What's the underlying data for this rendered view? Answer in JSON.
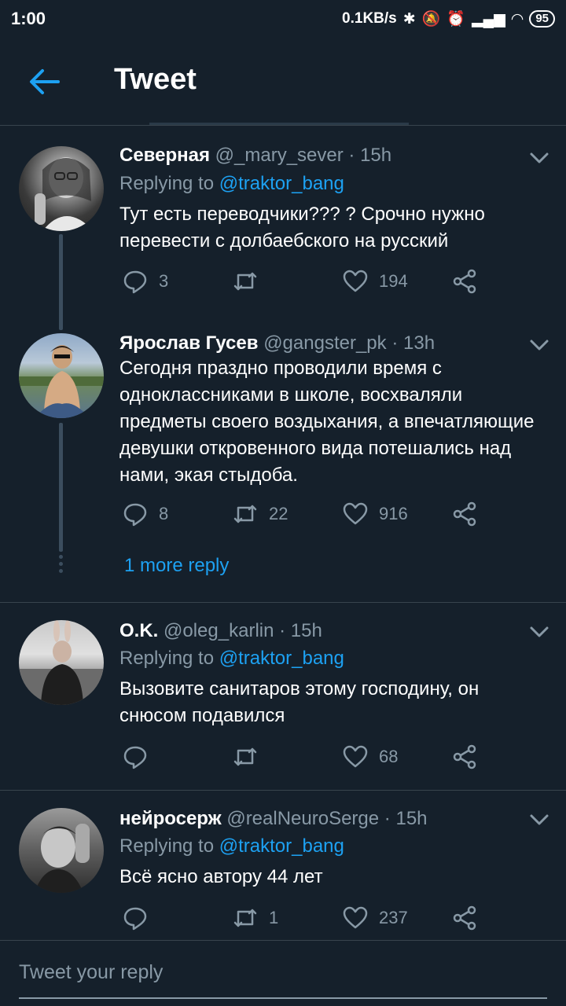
{
  "status_bar": {
    "time": "1:00",
    "speed": "0.1KB/s",
    "battery": "95"
  },
  "header": {
    "title": "Tweet"
  },
  "tweets": [
    {
      "name": "Северная",
      "handle": "@_mary_sever",
      "time": "15h",
      "replying_prefix": "Replying to",
      "replying_handle": "@traktor_bang",
      "text": "Тут есть переводчики??? ? Срочно нужно перевести с долбаебского на русский",
      "replies": "3",
      "retweets": "",
      "likes": "194"
    },
    {
      "name": "Ярослав Гусев",
      "handle": "@gangster_pk",
      "time": "13h",
      "text": "Сегодня праздно проводили время с одноклассниками в школе, восхваляли предметы своего воздыхания, а впечатляющие девушки откровенного вида потешались над нами, экая стыдоба.",
      "replies": "8",
      "retweets": "22",
      "likes": "916"
    },
    {
      "name": "O.K.",
      "handle": "@oleg_karlin",
      "time": "15h",
      "replying_prefix": "Replying to",
      "replying_handle": "@traktor_bang",
      "text": "Вызовите санитаров этому господину, он снюсом подавился",
      "replies": "",
      "retweets": "",
      "likes": "68"
    },
    {
      "name": "нейросерж",
      "handle": "@realNeuroSerge",
      "time": "15h",
      "replying_prefix": "Replying to",
      "replying_handle": "@traktor_bang",
      "text": "Всё ясно автору 44 лет",
      "replies": "",
      "retweets": "1",
      "likes": "237"
    }
  ],
  "more_reply": "1 more reply",
  "compose": {
    "placeholder": "Tweet your reply"
  },
  "colors": {
    "background": "#15202b",
    "accent": "#1da1f2",
    "secondary_text": "#8899a6",
    "divider": "#38444d"
  }
}
